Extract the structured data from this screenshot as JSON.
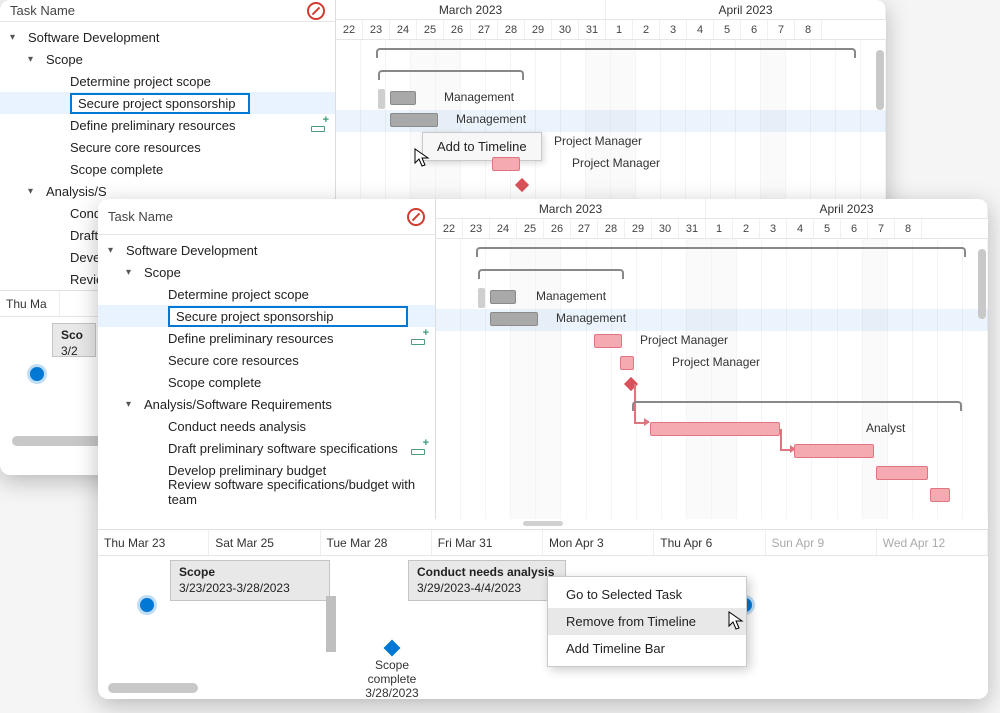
{
  "header": {
    "taskName": "Task Name"
  },
  "months": {
    "march": "March 2023",
    "april": "April 2023"
  },
  "days_back": [
    "22",
    "23",
    "24",
    "25",
    "26",
    "27",
    "28",
    "29",
    "30",
    "31",
    "1",
    "2",
    "3",
    "4",
    "5",
    "6",
    "7",
    "8"
  ],
  "days_front": [
    "22",
    "23",
    "24",
    "25",
    "26",
    "27",
    "28",
    "29",
    "30",
    "31",
    "1",
    "2",
    "3",
    "4",
    "5",
    "6",
    "7",
    "8"
  ],
  "tree": {
    "root": "Software Development",
    "scope": "Scope",
    "determine": "Determine project scope",
    "secure_sponsor": "Secure project sponsorship",
    "define_prelim": "Define preliminary resources",
    "secure_core": "Secure core resources",
    "scope_complete": "Scope complete",
    "analysis": "Analysis/Software Requirements",
    "analysis_short": "Analysis/S",
    "conduct": "Conduct needs analysis",
    "conduct_short": "Cond",
    "draft": "Draft preliminary software specifications",
    "draft_short": "Draft",
    "develop": "Develop preliminary budget",
    "develop_short": "Devel",
    "review": "Review software specifications/budget with team",
    "review_short": "Revie"
  },
  "resources": {
    "management": "Management",
    "pm": "Project Manager",
    "analyst": "Analyst"
  },
  "tooltip": {
    "add": "Add to Timeline"
  },
  "timeline_back": {
    "thu23_short": "Thu Ma",
    "scope_t": "Sco",
    "scope_d": "3/2"
  },
  "timeline_front": {
    "dates": [
      "Thu Mar 23",
      "Sat Mar 25",
      "Tue Mar 28",
      "Fri Mar 31",
      "Mon Apr 3",
      "Thu Apr 6",
      "Sun Apr 9",
      "Wed Apr 12"
    ],
    "scope_t": "Scope",
    "scope_d": "3/23/2023-3/28/2023",
    "cna_t": "Conduct needs analysis",
    "cna_d": "3/29/2023-4/4/2023",
    "ms_label": "Scope complete",
    "ms_date": "3/28/2023"
  },
  "ctx": {
    "goto": "Go to Selected Task",
    "remove": "Remove from Timeline",
    "addbar": "Add Timeline Bar"
  }
}
